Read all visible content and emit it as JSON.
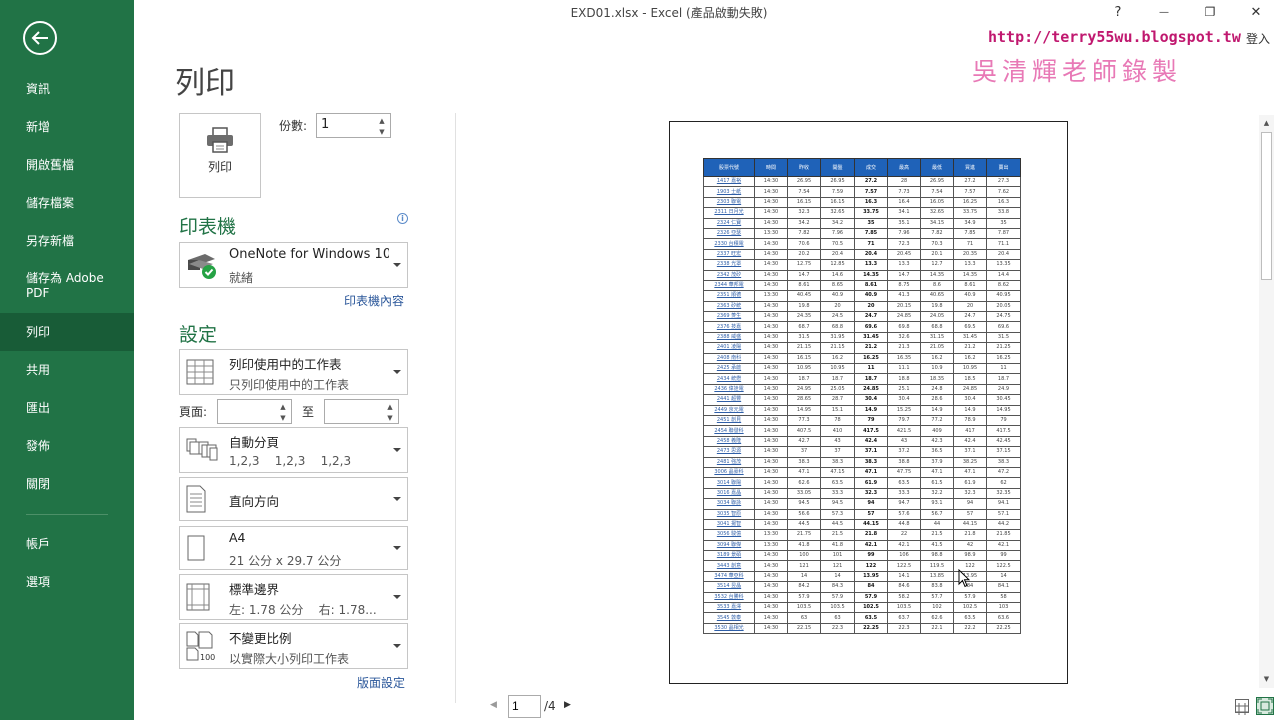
{
  "window": {
    "title": "EXD01.xlsx - Excel (產品啟動失敗)",
    "help": "?",
    "minimize": "—",
    "restore": "❐",
    "close": "✕",
    "login": "登入"
  },
  "watermark": {
    "url": "http://terry55wu.blogspot.tw",
    "name": "吳清輝老師錄製"
  },
  "sidebar": {
    "items": [
      {
        "label": "資訊"
      },
      {
        "label": "新增"
      },
      {
        "label": "開啟舊檔"
      },
      {
        "label": "儲存檔案"
      },
      {
        "label": "另存新檔"
      },
      {
        "label": "儲存為 Adobe PDF"
      },
      {
        "label": "列印"
      },
      {
        "label": "共用"
      },
      {
        "label": "匯出"
      },
      {
        "label": "發佈"
      },
      {
        "label": "關閉"
      },
      {
        "label": "帳戶"
      },
      {
        "label": "選項"
      }
    ]
  },
  "print": {
    "title": "列印",
    "button_label": "列印",
    "copies_label": "份數:",
    "copies_value": "1"
  },
  "printer": {
    "heading": "印表機",
    "name": "OneNote for Windows 10",
    "status": "就緒",
    "properties_link": "印表機內容"
  },
  "settings": {
    "heading": "設定",
    "what": {
      "title": "列印使用中的工作表",
      "sub": "只列印使用中的工作表"
    },
    "pages_label": "頁面:",
    "to_label": "至",
    "collate": {
      "title": "自動分頁",
      "sub": "1,2,3    1,2,3    1,2,3"
    },
    "orientation": {
      "title": "直向方向"
    },
    "paper": {
      "title": "A4",
      "sub": "21 公分 x 29.7 公分"
    },
    "margins": {
      "title": "標準邊界",
      "sub": "左: 1.78 公分    右: 1.78..."
    },
    "scaling": {
      "title": "不變更比例",
      "sub": "以實際大小列印工作表"
    },
    "page_setup_link": "版面設定"
  },
  "navigation": {
    "current_page": "1",
    "total": "/4"
  },
  "sheet": {
    "headers": [
      "股票代號",
      "時間",
      "昨收",
      "開盤",
      "成交",
      "最高",
      "最低",
      "買進",
      "賣出"
    ],
    "rows": [
      [
        "1417 嘉裕",
        "14:30",
        "26.95",
        "26.95",
        "27.2",
        "28",
        "26.95",
        "27.2",
        "27.3"
      ],
      [
        "1903 士紙",
        "14:30",
        "7.54",
        "7.59",
        "7.57",
        "7.73",
        "7.54",
        "7.57",
        "7.62"
      ],
      [
        "2303 聯電",
        "14:30",
        "16.15",
        "16.15",
        "16.3",
        "16.4",
        "16.05",
        "16.25",
        "16.3"
      ],
      [
        "2311 日月光",
        "14:30",
        "32.3",
        "32.65",
        "33.75",
        "34.1",
        "32.65",
        "33.75",
        "33.8"
      ],
      [
        "2324 仁寶",
        "14:30",
        "34.2",
        "34.2",
        "35",
        "35.1",
        "34.15",
        "34.9",
        "35"
      ],
      [
        "2326 亞瑟",
        "13:30",
        "7.82",
        "7.96",
        "7.85",
        "7.96",
        "7.82",
        "7.85",
        "7.87"
      ],
      [
        "2330 台積電",
        "14:30",
        "70.6",
        "70.5",
        "71",
        "72.3",
        "70.3",
        "71",
        "71.1"
      ],
      [
        "2337 旺宏",
        "14:30",
        "20.2",
        "20.4",
        "20.4",
        "20.45",
        "20.1",
        "20.35",
        "20.4"
      ],
      [
        "2338 光罩",
        "14:30",
        "12.75",
        "12.85",
        "13.3",
        "13.3",
        "12.7",
        "13.3",
        "13.35"
      ],
      [
        "2342 茂矽",
        "14:30",
        "14.7",
        "14.6",
        "14.35",
        "14.7",
        "14.35",
        "14.35",
        "14.4"
      ],
      [
        "2344 華邦電",
        "14:30",
        "8.61",
        "8.65",
        "8.61",
        "8.75",
        "8.6",
        "8.61",
        "8.62"
      ],
      [
        "2351 順德",
        "13:30",
        "40.45",
        "40.9",
        "40.9",
        "41.3",
        "40.65",
        "40.9",
        "40.95"
      ],
      [
        "2363 矽統",
        "14:30",
        "19.8",
        "20",
        "20",
        "20.15",
        "19.8",
        "20",
        "20.05"
      ],
      [
        "2369 菱生",
        "14:30",
        "24.35",
        "24.5",
        "24.7",
        "24.85",
        "24.05",
        "24.7",
        "24.75"
      ],
      [
        "2376 技嘉",
        "14:30",
        "68.7",
        "68.8",
        "69.6",
        "69.8",
        "68.8",
        "69.5",
        "69.6"
      ],
      [
        "2388 威盛",
        "14:30",
        "31.5",
        "31.95",
        "31.45",
        "32.6",
        "31.15",
        "31.45",
        "31.5"
      ],
      [
        "2401 凌陽",
        "14:30",
        "21.15",
        "21.15",
        "21.2",
        "21.3",
        "21.05",
        "21.2",
        "21.25"
      ],
      [
        "2408 南科",
        "14:30",
        "16.15",
        "16.2",
        "16.25",
        "16.35",
        "16.2",
        "16.2",
        "16.25"
      ],
      [
        "2425 承啟",
        "14:30",
        "10.95",
        "10.95",
        "11",
        "11.1",
        "10.9",
        "10.95",
        "11"
      ],
      [
        "2434 統懋",
        "14:30",
        "18.7",
        "18.7",
        "18.7",
        "18.8",
        "18.35",
        "18.5",
        "18.7"
      ],
      [
        "2436 偉詮電",
        "14:30",
        "24.95",
        "25.05",
        "24.85",
        "25.1",
        "24.8",
        "24.85",
        "24.9"
      ],
      [
        "2441 超豐",
        "14:30",
        "28.65",
        "28.7",
        "30.4",
        "30.4",
        "28.6",
        "30.4",
        "30.45"
      ],
      [
        "2449 京元電",
        "14:30",
        "14.95",
        "15.1",
        "14.9",
        "15.25",
        "14.9",
        "14.9",
        "14.95"
      ],
      [
        "2451 創見",
        "14:30",
        "77.3",
        "78",
        "79",
        "79.7",
        "77.2",
        "78.9",
        "79"
      ],
      [
        "2454 聯發科",
        "14:30",
        "407.5",
        "410",
        "417.5",
        "421.5",
        "409",
        "417",
        "417.5"
      ],
      [
        "2458 義隆",
        "14:30",
        "42.7",
        "43",
        "42.4",
        "43",
        "42.3",
        "42.4",
        "42.45"
      ],
      [
        "2473 思源",
        "14:30",
        "37",
        "37",
        "37.1",
        "37.2",
        "36.5",
        "37.1",
        "37.15"
      ],
      [
        "2481 強茂",
        "14:30",
        "38.3",
        "38.3",
        "38.3",
        "38.8",
        "37.9",
        "38.25",
        "38.3"
      ],
      [
        "3006 晶豪科",
        "14:30",
        "47.1",
        "47.15",
        "47.1",
        "47.75",
        "47.1",
        "47.1",
        "47.2"
      ],
      [
        "3014 聯陽",
        "14:30",
        "62.6",
        "63.5",
        "61.9",
        "63.5",
        "61.5",
        "61.9",
        "62"
      ],
      [
        "3016 嘉晶",
        "14:30",
        "33.05",
        "33.3",
        "32.3",
        "33.3",
        "32.2",
        "32.3",
        "32.35"
      ],
      [
        "3034 聯詠",
        "14:30",
        "94.5",
        "94.5",
        "94",
        "94.7",
        "93.1",
        "94",
        "94.1"
      ],
      [
        "3035 智原",
        "14:30",
        "56.6",
        "57.3",
        "57",
        "57.6",
        "56.7",
        "57",
        "57.1"
      ],
      [
        "3041 揚智",
        "14:30",
        "44.5",
        "44.5",
        "44.15",
        "44.8",
        "44",
        "44.15",
        "44.2"
      ],
      [
        "3056 駿億",
        "13:30",
        "21.75",
        "21.5",
        "21.8",
        "22",
        "21.5",
        "21.8",
        "21.85"
      ],
      [
        "3094 聯傑",
        "13:30",
        "41.8",
        "41.8",
        "42.1",
        "42.1",
        "41.5",
        "42",
        "42.1"
      ],
      [
        "3189 景碩",
        "14:30",
        "100",
        "101",
        "99",
        "106",
        "98.8",
        "98.9",
        "99"
      ],
      [
        "3443 創意",
        "14:30",
        "121",
        "121",
        "122",
        "122.5",
        "119.5",
        "122",
        "122.5"
      ],
      [
        "3474 華亞科",
        "14:30",
        "14",
        "14",
        "13.95",
        "14.1",
        "13.85",
        "13.95",
        "14"
      ],
      [
        "3514 昱晶",
        "14:30",
        "84.2",
        "84.3",
        "84",
        "84.6",
        "83.8",
        "84",
        "84.1"
      ],
      [
        "3532 台勝科",
        "14:30",
        "57.9",
        "57.9",
        "57.9",
        "58.2",
        "57.7",
        "57.9",
        "58"
      ],
      [
        "3533 嘉澤",
        "14:30",
        "103.5",
        "103.5",
        "102.5",
        "103.5",
        "102",
        "102.5",
        "103"
      ],
      [
        "3545 敦泰",
        "14:30",
        "63",
        "63",
        "63.5",
        "63.7",
        "62.6",
        "63.5",
        "63.6"
      ],
      [
        "3530 晶相光",
        "14:30",
        "22.15",
        "22.3",
        "22.25",
        "22.3",
        "22.1",
        "22.2",
        "22.25"
      ]
    ]
  }
}
